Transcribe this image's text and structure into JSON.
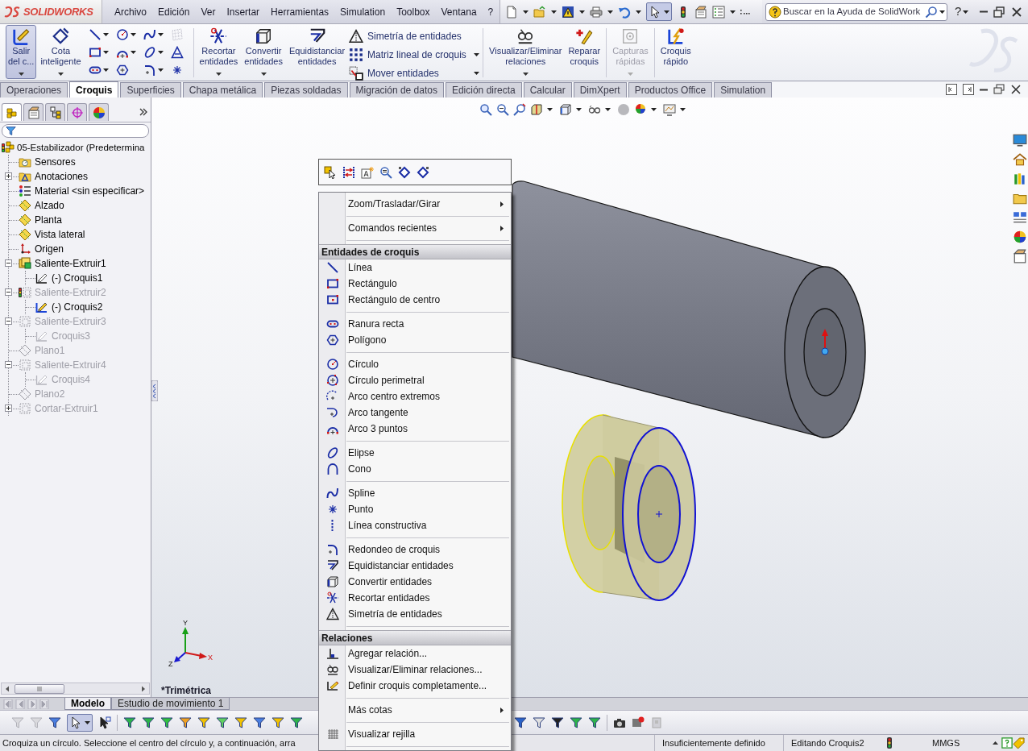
{
  "title_bar": {
    "logo": "SOLIDWORKS",
    "menu": [
      "Archivo",
      "Edición",
      "Ver",
      "Insertar",
      "Herramientas",
      "Simulation",
      "Toolbox",
      "Ventana",
      "?"
    ],
    "select_active": true,
    "search": {
      "placeholder": "Buscar en la Ayuda de SolidWork"
    },
    "help_button": "?"
  },
  "command_manager": {
    "sketch_buttons": [
      {
        "label": "Salir\ndel c...",
        "selected": true,
        "disabled": false,
        "dropdown": true
      },
      {
        "label": "Cota\ninteligente",
        "selected": false,
        "disabled": false,
        "dropdown": true
      }
    ],
    "edit_buttons": [
      {
        "label": "Recortar\nentidades",
        "selected": false,
        "disabled": false,
        "dropdown": true
      },
      {
        "label": "Convertir\nentidades",
        "selected": false,
        "disabled": false,
        "dropdown": true
      },
      {
        "label": "Equidistanciar\nentidades",
        "selected": false,
        "disabled": false,
        "dropdown": false
      }
    ],
    "list_buttons": [
      {
        "label": "Simetría de entidades",
        "dropdown": false
      },
      {
        "label": "Matriz lineal de croquis",
        "dropdown": true
      },
      {
        "label": "Mover entidades",
        "dropdown": true
      }
    ],
    "relation_buttons": [
      {
        "label": "Visualizar/Eliminar\nrelaciones",
        "selected": false,
        "disabled": false,
        "dropdown": true
      },
      {
        "label": "Reparar\ncroquis",
        "selected": false,
        "disabled": false,
        "dropdown": false
      }
    ],
    "extra_buttons": [
      {
        "label": "Capturas\nrápidas",
        "selected": false,
        "disabled": true,
        "dropdown": true
      },
      {
        "label": "Croquis\nrápido",
        "selected": false,
        "disabled": false,
        "dropdown": false
      }
    ]
  },
  "tabs": [
    {
      "label": "Operaciones",
      "selected": false
    },
    {
      "label": "Croquis",
      "selected": true
    },
    {
      "label": "Superficies",
      "selected": false
    },
    {
      "label": "Chapa metálica",
      "selected": false
    },
    {
      "label": "Piezas soldadas",
      "selected": false
    },
    {
      "label": "Migración de datos",
      "selected": false
    },
    {
      "label": "Edición directa",
      "selected": false
    },
    {
      "label": "Calcular",
      "selected": false
    },
    {
      "label": "DimXpert",
      "selected": false
    },
    {
      "label": "Productos Office",
      "selected": false
    },
    {
      "label": "Simulation",
      "selected": false
    }
  ],
  "feature_manager": {
    "panel_tabs": [
      {
        "selected": true
      },
      {
        "selected": false
      },
      {
        "selected": false
      },
      {
        "selected": false
      },
      {
        "selected": false
      }
    ],
    "tree": {
      "label": "05-Estabilizador (Predetermina",
      "kind": "part",
      "greyed": false,
      "editing": false,
      "children": [
        {
          "label": "Sensores",
          "kind": "sensors",
          "greyed": false
        },
        {
          "label": "Anotaciones",
          "kind": "annotations",
          "greyed": false,
          "expanded": false
        },
        {
          "label": "Material <sin especificar>",
          "kind": "material",
          "greyed": false
        },
        {
          "label": "Alzado",
          "kind": "plane",
          "greyed": false
        },
        {
          "label": "Planta",
          "kind": "plane",
          "greyed": false
        },
        {
          "label": "Vista lateral",
          "kind": "plane",
          "greyed": false
        },
        {
          "label": "Origen",
          "kind": "origin",
          "greyed": false
        },
        {
          "label": "Saliente-Extruir1",
          "kind": "extrude",
          "greyed": false,
          "editing": false,
          "expanded": true,
          "children": [
            {
              "label": "(-) Croquis1",
              "kind": "sketch",
              "greyed": false,
              "editing": false
            }
          ]
        },
        {
          "label": "Saliente-Extruir2",
          "kind": "extrude",
          "greyed": true,
          "editing": true,
          "expanded": true,
          "children": [
            {
              "label": "(-) Croquis2",
              "kind": "sketch",
              "greyed": false,
              "editing": true
            }
          ]
        },
        {
          "label": "Saliente-Extruir3",
          "kind": "extrude",
          "greyed": true,
          "editing": false,
          "expanded": true,
          "children": [
            {
              "label": "Croquis3",
              "kind": "sketch",
              "greyed": true,
              "editing": false
            }
          ]
        },
        {
          "label": "Plano1",
          "kind": "plane",
          "greyed": true
        },
        {
          "label": "Saliente-Extruir4",
          "kind": "extrude",
          "greyed": true,
          "editing": false,
          "expanded": true,
          "children": [
            {
              "label": "Croquis4",
              "kind": "sketch",
              "greyed": true,
              "editing": false
            }
          ]
        },
        {
          "label": "Plano2",
          "kind": "plane",
          "greyed": true
        },
        {
          "label": "Cortar-Extruir1",
          "kind": "cut",
          "greyed": true,
          "expanded": false
        }
      ]
    }
  },
  "graphics": {
    "view_label": "*Trimétrica",
    "triad": {
      "y": "Y",
      "x": "X",
      "z": "Z"
    }
  },
  "context_menu": {
    "entries": [
      {
        "kind": "submenu",
        "label": "Zoom/Trasladar/Girar"
      },
      {
        "kind": "separator"
      },
      {
        "kind": "submenu",
        "label": "Comandos recientes"
      },
      {
        "kind": "separator"
      },
      {
        "kind": "header",
        "label": "Entidades de croquis"
      },
      {
        "kind": "item",
        "label": "Línea"
      },
      {
        "kind": "item",
        "label": "Rectángulo"
      },
      {
        "kind": "item",
        "label": "Rectángulo de centro"
      },
      {
        "kind": "separator"
      },
      {
        "kind": "item",
        "label": "Ranura recta"
      },
      {
        "kind": "item",
        "label": "Polígono"
      },
      {
        "kind": "separator"
      },
      {
        "kind": "item",
        "label": "Círculo"
      },
      {
        "kind": "item",
        "label": "Círculo perimetral"
      },
      {
        "kind": "item",
        "label": "Arco centro extremos"
      },
      {
        "kind": "item",
        "label": "Arco tangente"
      },
      {
        "kind": "item",
        "label": "Arco 3 puntos"
      },
      {
        "kind": "separator"
      },
      {
        "kind": "item",
        "label": "Elipse"
      },
      {
        "kind": "item",
        "label": "Cono"
      },
      {
        "kind": "separator"
      },
      {
        "kind": "item",
        "label": "Spline"
      },
      {
        "kind": "item",
        "label": "Punto"
      },
      {
        "kind": "item",
        "label": "Línea constructiva"
      },
      {
        "kind": "separator"
      },
      {
        "kind": "item",
        "label": "Redondeo de croquis"
      },
      {
        "kind": "item",
        "label": "Equidistanciar entidades"
      },
      {
        "kind": "item",
        "label": "Convertir entidades"
      },
      {
        "kind": "item",
        "label": "Recortar entidades"
      },
      {
        "kind": "item",
        "label": "Simetría de entidades"
      },
      {
        "kind": "separator"
      },
      {
        "kind": "header",
        "label": "Relaciones"
      },
      {
        "kind": "item",
        "label": "Agregar relación..."
      },
      {
        "kind": "item",
        "label": "Visualizar/Eliminar relaciones..."
      },
      {
        "kind": "item",
        "label": "Definir croquis completamente..."
      },
      {
        "kind": "separator"
      },
      {
        "kind": "submenu",
        "label": "Más cotas"
      },
      {
        "kind": "separator"
      },
      {
        "kind": "item",
        "label": "Visualizar rejilla"
      },
      {
        "kind": "separator"
      }
    ]
  },
  "bottom_tabs": [
    {
      "label": "Modelo",
      "selected": true
    },
    {
      "label": "Estudio de movimiento 1",
      "selected": false
    }
  ],
  "selection_toolbar": {
    "select_active": true
  },
  "status_bar": {
    "message": "Croquiza un círculo. Seleccione el centro del círculo y, a continuación, arra",
    "definition": "Insuficientemente definido",
    "editing": "Editando Croquis2",
    "units": "MMGS"
  }
}
